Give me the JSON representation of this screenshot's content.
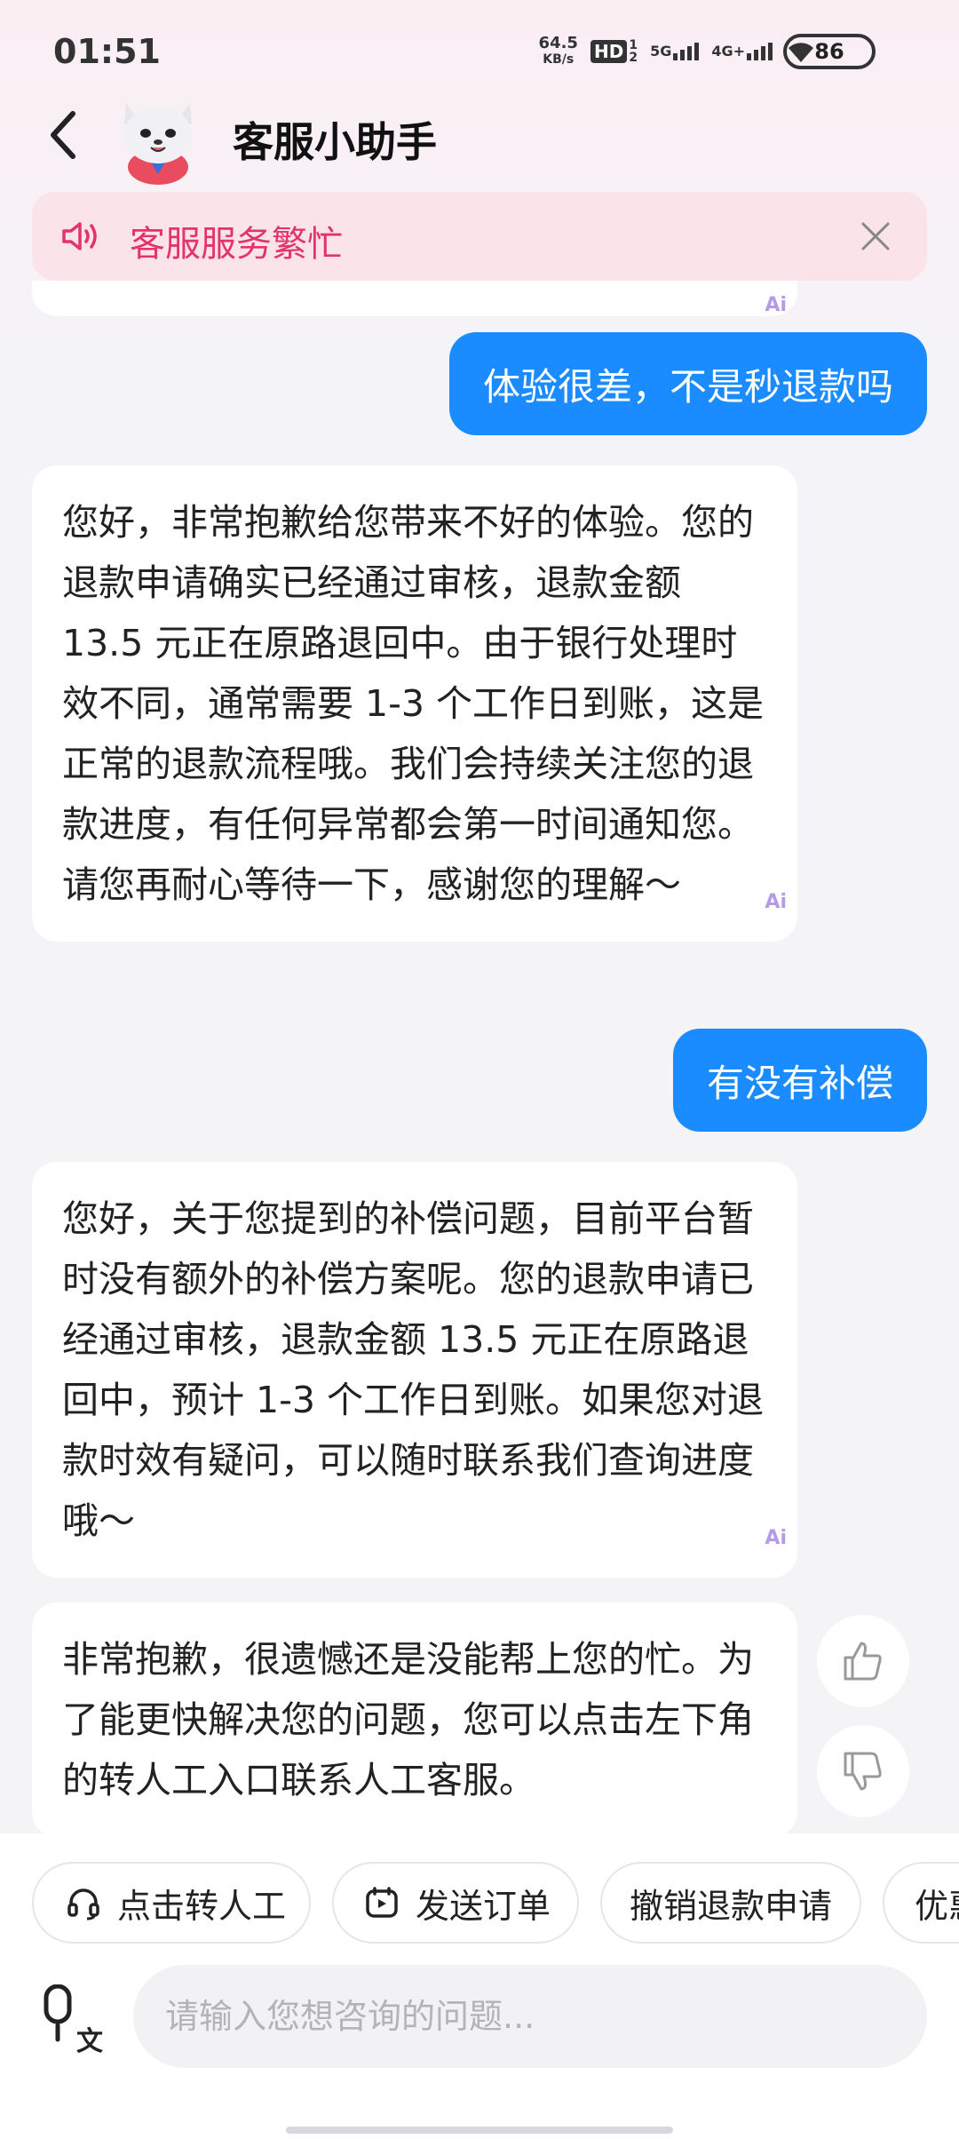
{
  "status_bar": {
    "time": "01:51",
    "net_speed_value": "64.5",
    "net_speed_unit": "KB/s",
    "hd_label": "HD",
    "hd_sub": "1",
    "hd_sub2": "2",
    "sig1_label": "5G",
    "sig2_label": "4G+",
    "battery": "86"
  },
  "header": {
    "title": "客服小助手",
    "back_icon": "chevron-left-icon",
    "avatar": "cat-mascot-avatar"
  },
  "notice": {
    "text": "客服服务繁忙",
    "icon": "speaker-icon",
    "close_icon": "close-icon",
    "accent": "#e2336b",
    "background": "#fbe3ea"
  },
  "messages": [
    {
      "role": "user",
      "text": "体验很差，不是秒退款吗"
    },
    {
      "role": "bot",
      "text": "您好，非常抱歉给您带来不好的体验。您的退款申请确实已经通过审核，退款金额 13.5 元正在原路退回中。由于银行处理时效不同，通常需要 1-3 个工作日到账，这是正常的退款流程哦。我们会持续关注您的退款进度，有任何异常都会第一时间通知您。请您再耐心等待一下，感谢您的理解～",
      "tag": "Ai"
    },
    {
      "role": "user",
      "text": "有没有补偿"
    },
    {
      "role": "bot",
      "text": "您好，关于您提到的补偿问题，目前平台暂时没有额外的补偿方案呢。您的退款申请已经通过审核，退款金额 13.5 元正在原路退回中，预计 1-3 个工作日到账。如果您对退款时效有疑问，可以随时联系我们查询进度哦～",
      "tag": "Ai"
    },
    {
      "role": "bot",
      "text": "非常抱歉，很遗憾还是没能帮上您的忙。为了能更快解决您的问题，您可以点击左下角的转人工入口联系人工客服。"
    }
  ],
  "feedback": {
    "like_icon": "thumbs-up-icon",
    "dislike_icon": "thumbs-down-icon"
  },
  "quick_actions": [
    {
      "label": "点击转人工",
      "icon": "headset-icon"
    },
    {
      "label": "发送订单",
      "icon": "order-icon"
    },
    {
      "label": "撤销退款申请"
    },
    {
      "label": "优惠"
    }
  ],
  "input": {
    "placeholder": "请输入您想咨询的问题...",
    "value": "",
    "voice_icon": "voice-translate-icon",
    "voice_sub": "文"
  },
  "colors": {
    "user_bubble": "#1a8cff",
    "ai_tag": "#b59ae6"
  }
}
